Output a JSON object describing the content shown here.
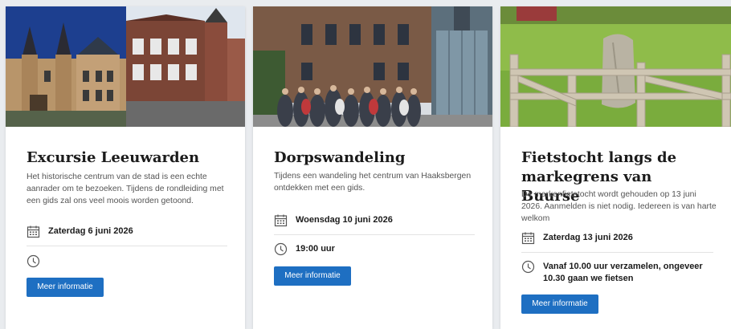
{
  "cards": [
    {
      "title": "Excursie Leeuwarden",
      "description": "Het historische centrum van de stad is een echte aanrader om te bezoeken. Tijdens de rondleiding met een gids zal ons veel moois worden getoond.",
      "date": "Zaterdag 6 juni 2026",
      "time": "",
      "button": "Meer informatie",
      "date_icon": "calendar-icon",
      "time_icon": "clock-icon"
    },
    {
      "title": "Dorpswandeling",
      "description": "Tijdens een wandeling het centrum van Haaksbergen ontdekken met een gids.",
      "date": "Woensdag 10 juni 2026",
      "time": "19:00 uur",
      "button": "Meer informatie",
      "date_icon": "calendar-icon",
      "time_icon": "clock-icon"
    },
    {
      "title": "Fietstocht langs de markegrens van Buurse",
      "description": "De markenfietstocht wordt gehouden op 13 juni 2026. Aanmelden is niet nodig. Iedereen is van harte welkom",
      "date": "Zaterdag 13 juni 2026",
      "time": "Vanaf 10.00 uur verzamelen, ongeveer 10.30 gaan we fietsen",
      "button": "Meer informatie",
      "date_icon": "calendar-icon",
      "time_icon": "clock-icon"
    }
  ],
  "colors": {
    "button": "#1e6fc2",
    "title": "#1b1b1b",
    "text": "#555555"
  }
}
